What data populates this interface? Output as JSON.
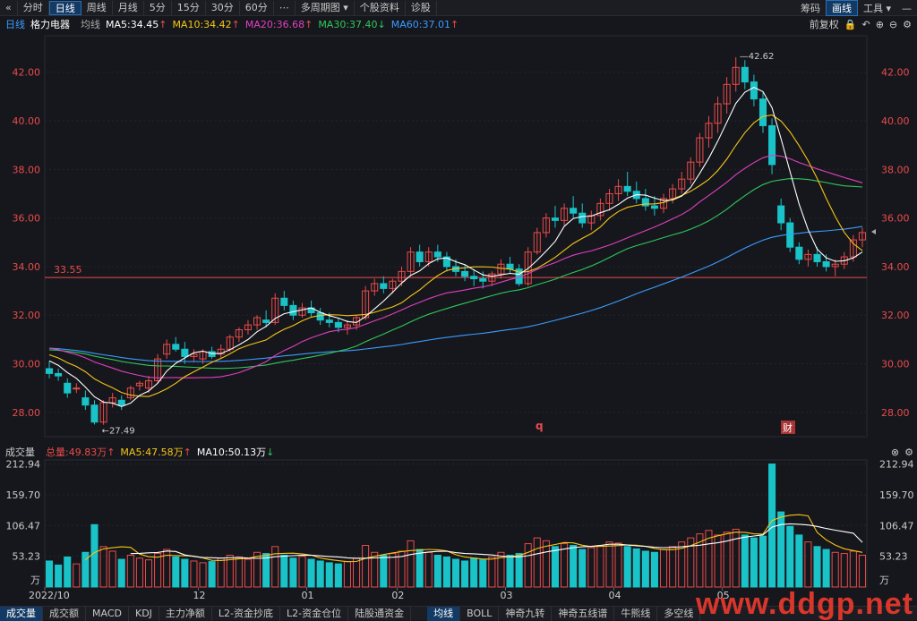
{
  "toolbar": {
    "back_icon": "double-chevron-left-icon",
    "tabs": [
      "分时",
      "日线",
      "周线",
      "月线",
      "5分",
      "15分",
      "30分",
      "60分",
      "⋯",
      "多周期图",
      "个股资料",
      "诊股"
    ],
    "active_tab": "日线",
    "multi_period_dropdown_icon": "caret-down-icon",
    "right": [
      "筹码",
      "画线",
      "工具"
    ],
    "right_active": "画线"
  },
  "ma_header": {
    "period": "日线",
    "stock": "格力电器",
    "avg_label": "均线",
    "ma5": "MA5:34.45",
    "ma10": "MA10:34.42",
    "ma20": "MA20:36.68",
    "ma30": "MA30:37.40",
    "ma60": "MA60:37.01",
    "ma5_arrow": "↑",
    "ma10_arrow": "↑",
    "ma20_arrow": "↑",
    "ma30_arrow": "↓",
    "ma60_arrow": "↑",
    "fq": "前复权",
    "colors": {
      "ma5": "#ffffff",
      "ma10": "#f5c518",
      "ma20": "#e040c0",
      "ma30": "#2fc85a",
      "ma60": "#3a9cff"
    }
  },
  "price_axis": {
    "ticks": [
      "42.00",
      "40.00",
      "38.00",
      "36.00",
      "34.00",
      "32.00",
      "30.00",
      "28.00"
    ],
    "values": [
      42,
      40,
      38,
      36,
      34,
      32,
      30,
      28
    ]
  },
  "annotations": {
    "high": "42.62",
    "low": "27.49",
    "hline": "33.55",
    "q_marker": "q",
    "cai_marker": "财"
  },
  "volume_header": {
    "title": "成交量",
    "total": "总量:49.83万",
    "total_arrow": "↑",
    "ma5": "MA5:47.58万",
    "ma5_arrow": "↑",
    "ma10": "MA10:50.13万",
    "ma10_arrow": "↓"
  },
  "volume_axis": {
    "ticks": [
      "212.94",
      "159.70",
      "106.47",
      "53.23"
    ],
    "unit": "万"
  },
  "date_axis": [
    "2022/10",
    "12",
    "01",
    "02",
    "03",
    "04",
    "05"
  ],
  "bottom_tabs": [
    "成交量",
    "成交额",
    "MACD",
    "KDJ",
    "主力净额",
    "L2-资金抄底",
    "L2-资金仓位",
    "陆股通资金",
    "均线",
    "BOLL",
    "神奇九转",
    "神奇五线谱",
    "牛熊线",
    "多空线"
  ],
  "bottom_active": [
    "成交量",
    "均线"
  ],
  "watermark": "www.ddgp.net",
  "chart_data": {
    "type": "candlestick",
    "price_range": [
      27,
      43.5
    ],
    "volume_range": [
      0,
      220
    ],
    "ohlc": [
      [
        29.8,
        30.1,
        29.4,
        29.6
      ],
      [
        29.6,
        29.8,
        29.3,
        29.5
      ],
      [
        29.2,
        29.4,
        28.6,
        28.8
      ],
      [
        29.0,
        29.2,
        28.8,
        29.0
      ],
      [
        28.6,
        28.9,
        28.1,
        28.3
      ],
      [
        28.3,
        28.5,
        27.5,
        27.6
      ],
      [
        27.6,
        28.5,
        27.49,
        28.4
      ],
      [
        28.4,
        28.8,
        28.2,
        28.6
      ],
      [
        28.5,
        28.7,
        28.1,
        28.3
      ],
      [
        28.6,
        29.1,
        28.5,
        29.0
      ],
      [
        29.1,
        29.3,
        28.9,
        29.2
      ],
      [
        29.0,
        29.5,
        28.8,
        29.3
      ],
      [
        29.3,
        30.4,
        29.2,
        30.2
      ],
      [
        30.4,
        31.0,
        30.2,
        30.8
      ],
      [
        30.8,
        31.1,
        30.5,
        30.6
      ],
      [
        30.6,
        30.9,
        30.0,
        30.3
      ],
      [
        30.3,
        30.6,
        30.1,
        30.4
      ],
      [
        30.2,
        30.6,
        30.0,
        30.5
      ],
      [
        30.5,
        30.7,
        30.2,
        30.3
      ],
      [
        30.4,
        30.8,
        30.2,
        30.6
      ],
      [
        30.6,
        31.2,
        30.5,
        31.1
      ],
      [
        31.1,
        31.5,
        30.9,
        31.4
      ],
      [
        31.4,
        31.8,
        31.2,
        31.6
      ],
      [
        31.6,
        32.0,
        31.4,
        31.9
      ],
      [
        31.8,
        32.2,
        31.5,
        31.7
      ],
      [
        31.7,
        32.9,
        31.6,
        32.7
      ],
      [
        32.7,
        33.0,
        32.2,
        32.4
      ],
      [
        32.4,
        32.6,
        31.8,
        32.0
      ],
      [
        32.0,
        32.5,
        31.9,
        32.3
      ],
      [
        32.3,
        32.6,
        31.9,
        32.1
      ],
      [
        32.1,
        32.3,
        31.6,
        31.8
      ],
      [
        31.8,
        32.1,
        31.5,
        31.7
      ],
      [
        31.7,
        31.9,
        31.3,
        31.5
      ],
      [
        31.5,
        31.8,
        31.2,
        31.6
      ],
      [
        31.6,
        32.0,
        31.4,
        31.9
      ],
      [
        31.9,
        33.2,
        31.8,
        33.0
      ],
      [
        33.0,
        33.5,
        32.8,
        33.3
      ],
      [
        33.3,
        33.6,
        32.9,
        33.1
      ],
      [
        33.1,
        33.5,
        32.9,
        33.4
      ],
      [
        33.4,
        34.0,
        33.2,
        33.8
      ],
      [
        33.8,
        34.8,
        33.6,
        34.6
      ],
      [
        34.6,
        34.9,
        34.0,
        34.2
      ],
      [
        34.2,
        34.8,
        34.0,
        34.6
      ],
      [
        34.6,
        34.9,
        34.2,
        34.4
      ],
      [
        34.4,
        34.6,
        33.8,
        34.0
      ],
      [
        34.0,
        34.3,
        33.6,
        33.8
      ],
      [
        33.8,
        34.1,
        33.4,
        33.6
      ],
      [
        33.6,
        33.9,
        33.2,
        33.5
      ],
      [
        33.5,
        33.8,
        33.1,
        33.4
      ],
      [
        33.4,
        33.8,
        33.2,
        33.7
      ],
      [
        33.7,
        34.3,
        33.5,
        34.1
      ],
      [
        34.1,
        34.4,
        33.7,
        33.9
      ],
      [
        33.9,
        34.1,
        33.2,
        33.3
      ],
      [
        33.3,
        34.8,
        33.2,
        34.6
      ],
      [
        34.6,
        35.6,
        34.5,
        35.4
      ],
      [
        35.4,
        36.2,
        35.2,
        36.0
      ],
      [
        36.0,
        36.5,
        35.6,
        35.9
      ],
      [
        35.9,
        36.6,
        35.7,
        36.4
      ],
      [
        36.4,
        36.9,
        36.0,
        36.2
      ],
      [
        36.2,
        36.6,
        35.6,
        35.8
      ],
      [
        35.8,
        36.3,
        35.5,
        36.1
      ],
      [
        36.1,
        36.8,
        35.9,
        36.6
      ],
      [
        36.6,
        37.2,
        36.3,
        37.0
      ],
      [
        37.0,
        37.6,
        36.7,
        37.3
      ],
      [
        37.3,
        37.9,
        36.9,
        37.1
      ],
      [
        37.1,
        37.5,
        36.6,
        36.8
      ],
      [
        36.8,
        37.2,
        36.3,
        36.5
      ],
      [
        36.5,
        36.9,
        36.1,
        36.4
      ],
      [
        36.4,
        37.0,
        36.2,
        36.8
      ],
      [
        36.8,
        37.4,
        36.6,
        37.2
      ],
      [
        37.2,
        37.9,
        37.0,
        37.6
      ],
      [
        37.6,
        38.5,
        37.4,
        38.3
      ],
      [
        38.3,
        39.5,
        38.1,
        39.3
      ],
      [
        39.3,
        40.2,
        38.9,
        39.9
      ],
      [
        39.9,
        41.0,
        39.5,
        40.7
      ],
      [
        40.7,
        41.8,
        40.3,
        41.5
      ],
      [
        41.5,
        42.62,
        41.2,
        42.2
      ],
      [
        42.2,
        42.5,
        41.3,
        41.6
      ],
      [
        41.6,
        41.9,
        40.6,
        40.9
      ],
      [
        40.9,
        41.2,
        39.5,
        39.8
      ],
      [
        39.8,
        40.1,
        37.8,
        38.2
      ],
      [
        36.5,
        36.8,
        35.5,
        35.8
      ],
      [
        35.8,
        36.0,
        34.6,
        34.8
      ],
      [
        34.8,
        35.0,
        34.1,
        34.3
      ],
      [
        34.3,
        34.7,
        34.0,
        34.5
      ],
      [
        34.5,
        34.8,
        34.0,
        34.2
      ],
      [
        34.2,
        34.5,
        33.8,
        34.0
      ],
      [
        34.0,
        34.3,
        33.6,
        34.1
      ],
      [
        34.1,
        34.6,
        33.9,
        34.4
      ],
      [
        34.4,
        35.3,
        34.2,
        35.1
      ],
      [
        35.1,
        35.6,
        34.8,
        35.4
      ]
    ],
    "volume": [
      45,
      38,
      52,
      40,
      60,
      108,
      70,
      62,
      48,
      55,
      50,
      47,
      58,
      65,
      52,
      48,
      45,
      42,
      44,
      50,
      55,
      52,
      48,
      60,
      58,
      70,
      55,
      50,
      53,
      48,
      45,
      42,
      40,
      44,
      50,
      72,
      60,
      55,
      58,
      62,
      80,
      65,
      60,
      55,
      52,
      48,
      45,
      50,
      47,
      52,
      60,
      55,
      58,
      75,
      85,
      80,
      70,
      75,
      72,
      65,
      68,
      72,
      78,
      76,
      70,
      66,
      62,
      60,
      65,
      70,
      78,
      85,
      92,
      98,
      90,
      95,
      100,
      90,
      85,
      88,
      212.94,
      130,
      105,
      90,
      78,
      70,
      65,
      60,
      58,
      62,
      55
    ]
  }
}
